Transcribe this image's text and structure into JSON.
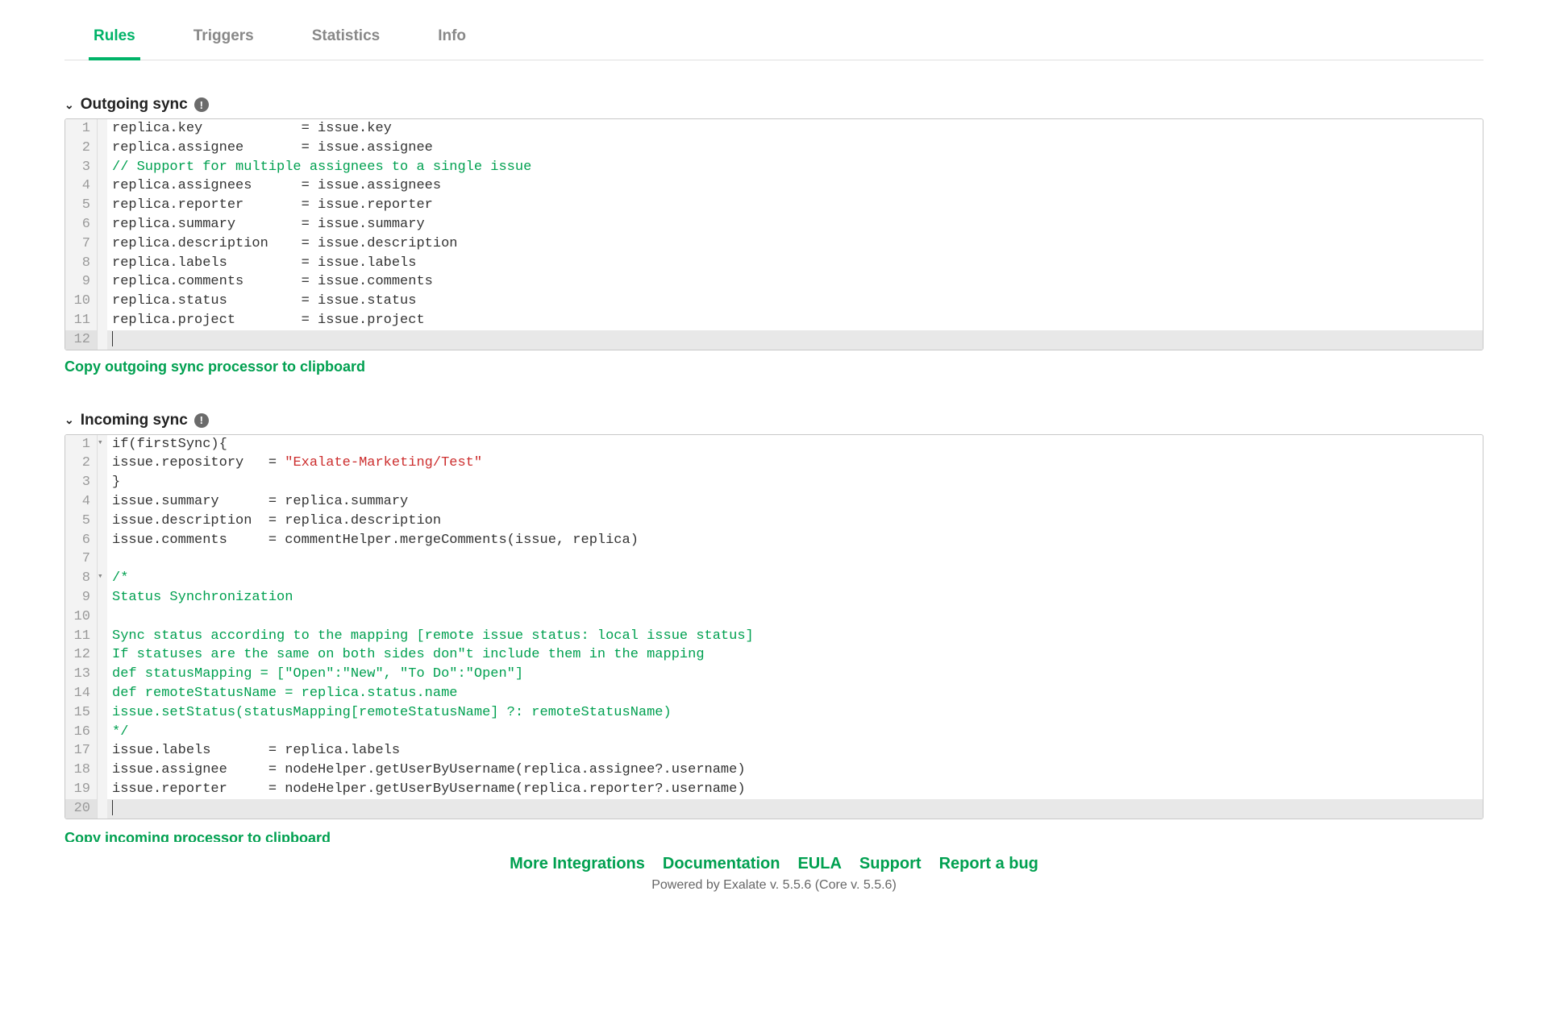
{
  "tabs": {
    "rules": "Rules",
    "triggers": "Triggers",
    "statistics": "Statistics",
    "info": "Info"
  },
  "sections": {
    "outgoing": {
      "title": "Outgoing sync",
      "copy_label": "Copy outgoing sync processor to clipboard",
      "code": [
        {
          "n": 1,
          "fold": "",
          "plain": "replica.key            = issue.key"
        },
        {
          "n": 2,
          "fold": "",
          "plain": "replica.assignee       = issue.assignee"
        },
        {
          "n": 3,
          "fold": "",
          "comment": "// Support for multiple assignees to a single issue"
        },
        {
          "n": 4,
          "fold": "",
          "plain": "replica.assignees      = issue.assignees"
        },
        {
          "n": 5,
          "fold": "",
          "plain": "replica.reporter       = issue.reporter"
        },
        {
          "n": 6,
          "fold": "",
          "plain": "replica.summary        = issue.summary"
        },
        {
          "n": 7,
          "fold": "",
          "plain": "replica.description    = issue.description"
        },
        {
          "n": 8,
          "fold": "",
          "plain": "replica.labels         = issue.labels"
        },
        {
          "n": 9,
          "fold": "",
          "plain": "replica.comments       = issue.comments"
        },
        {
          "n": 10,
          "fold": "",
          "plain": "replica.status         = issue.status"
        },
        {
          "n": 11,
          "fold": "",
          "plain": "replica.project        = issue.project"
        },
        {
          "n": 12,
          "fold": "",
          "empty": true
        }
      ]
    },
    "incoming": {
      "title": "Incoming sync",
      "copy_label": "Copy incoming processor to clipboard",
      "code": [
        {
          "n": 1,
          "fold": "▾",
          "plain": "if(firstSync){"
        },
        {
          "n": 2,
          "fold": "",
          "pre": "issue.repository   = ",
          "string": "\"Exalate-Marketing/Test\""
        },
        {
          "n": 3,
          "fold": "",
          "plain": "}"
        },
        {
          "n": 4,
          "fold": "",
          "plain": "issue.summary      = replica.summary"
        },
        {
          "n": 5,
          "fold": "",
          "plain": "issue.description  = replica.description"
        },
        {
          "n": 6,
          "fold": "",
          "plain": "issue.comments     = commentHelper.mergeComments(issue, replica)"
        },
        {
          "n": 7,
          "fold": "",
          "plain": ""
        },
        {
          "n": 8,
          "fold": "▾",
          "comment": "/*"
        },
        {
          "n": 9,
          "fold": "",
          "comment": "Status Synchronization"
        },
        {
          "n": 10,
          "fold": "",
          "comment": ""
        },
        {
          "n": 11,
          "fold": "",
          "comment": "Sync status according to the mapping [remote issue status: local issue status]"
        },
        {
          "n": 12,
          "fold": "",
          "comment": "If statuses are the same on both sides don\"t include them in the mapping"
        },
        {
          "n": 13,
          "fold": "",
          "comment": "def statusMapping = [\"Open\":\"New\", \"To Do\":\"Open\"]"
        },
        {
          "n": 14,
          "fold": "",
          "comment": "def remoteStatusName = replica.status.name"
        },
        {
          "n": 15,
          "fold": "",
          "comment": "issue.setStatus(statusMapping[remoteStatusName] ?: remoteStatusName)"
        },
        {
          "n": 16,
          "fold": "",
          "comment": "*/"
        },
        {
          "n": 17,
          "fold": "",
          "plain": "issue.labels       = replica.labels"
        },
        {
          "n": 18,
          "fold": "",
          "plain": "issue.assignee     = nodeHelper.getUserByUsername(replica.assignee?.username)"
        },
        {
          "n": 19,
          "fold": "",
          "plain": "issue.reporter     = nodeHelper.getUserByUsername(replica.reporter?.username)"
        },
        {
          "n": 20,
          "fold": "",
          "empty": true
        }
      ]
    }
  },
  "footer": {
    "links": {
      "more": "More Integrations",
      "docs": "Documentation",
      "eula": "EULA",
      "support": "Support",
      "bug": "Report a bug"
    },
    "powered": "Powered by Exalate v. 5.5.6 (Core v. 5.5.6)"
  },
  "icons": {
    "info": "!"
  }
}
